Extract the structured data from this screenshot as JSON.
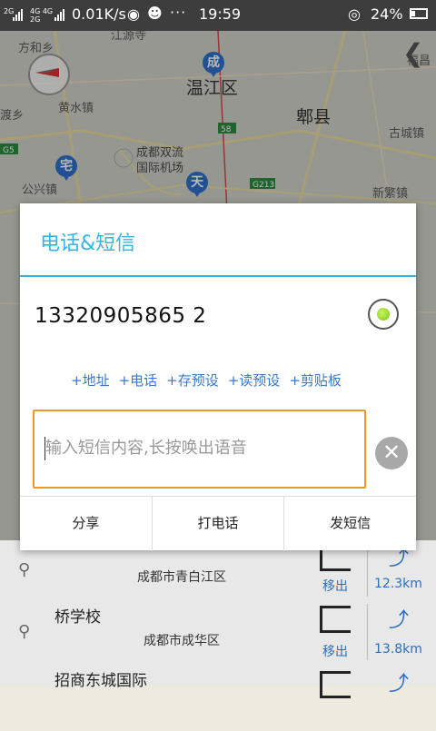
{
  "status_bar": {
    "signal_1": "2G",
    "signal_2": "4G 4G",
    "signal_3": "2G",
    "net_speed": "0.01K/s",
    "more": "···",
    "time": "19:59",
    "battery": "24%"
  },
  "map": {
    "labels": {
      "fanghexiang": "方和乡",
      "jiangyuansi": "江源寺",
      "fuyi": "福昌",
      "boxiang": "渡乡",
      "huangshuizhen": "黄水镇",
      "wenjiangqu": "温江区",
      "pixian": "郫县",
      "gucheng": "古城镇",
      "chengdu_airport": "成都双流\n国际机场",
      "gongxingzhen": "公兴镇",
      "xinfanzhen": "新繁镇",
      "road_g5": "G5",
      "road_58": "58",
      "road_g213": "G213"
    },
    "pins": {
      "cheng": "成",
      "zhai": "宅",
      "tian": "天"
    }
  },
  "dialog": {
    "title": "电话&短信",
    "phone_number": "13320905865 2",
    "links": [
      "+地址",
      "+电话",
      "+存预设",
      "+读预设",
      "+剪贴板"
    ],
    "message_placeholder": "输入短信内容,长按唤出语音",
    "buttons": {
      "share": "分享",
      "call": "打电话",
      "sms": "发短信"
    }
  },
  "list": {
    "rows": [
      {
        "name": "",
        "address": "成都市青白江区",
        "action": "移出",
        "distance": "12.3km"
      },
      {
        "name": "桥学校",
        "address": "成都市成华区",
        "action": "移出",
        "distance": "13.8km"
      },
      {
        "name": "招商东城国际",
        "address": "",
        "action": "",
        "distance": ""
      }
    ]
  }
}
